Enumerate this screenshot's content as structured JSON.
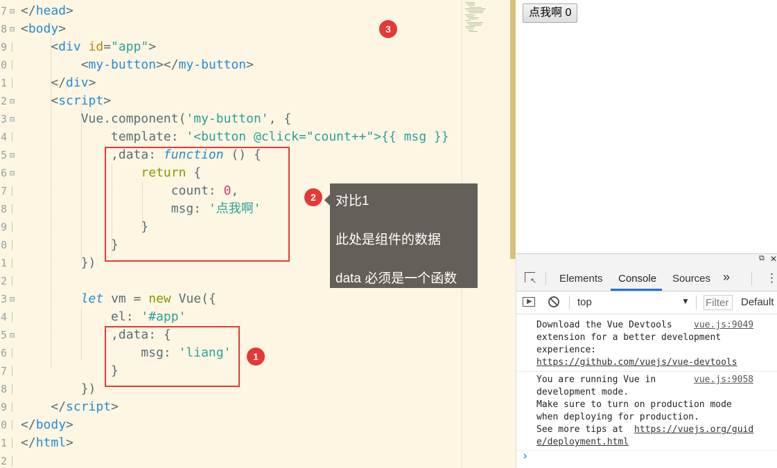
{
  "editor": {
    "line_numbers": [
      "7",
      "8",
      "9",
      "0",
      "1",
      "2",
      "3",
      "4",
      "5",
      "6",
      "7",
      "8",
      "9",
      "0",
      "1",
      "2",
      "3",
      "4",
      "5",
      "6",
      "7",
      "8",
      "9",
      "0",
      "1",
      "2"
    ],
    "lines": [
      [
        [
          "t-punct",
          "</"
        ],
        [
          "t-tag",
          "head"
        ],
        [
          "t-punct",
          ">"
        ]
      ],
      [
        [
          "t-punct",
          "<"
        ],
        [
          "t-tag",
          "body"
        ],
        [
          "t-punct",
          ">"
        ]
      ],
      [
        [
          "t-plain",
          "    "
        ],
        [
          "t-punct",
          "<"
        ],
        [
          "t-tag",
          "div "
        ],
        [
          "t-attr",
          "id"
        ],
        [
          "t-punct",
          "="
        ],
        [
          "t-str",
          "\"app\""
        ],
        [
          "t-punct",
          ">"
        ]
      ],
      [
        [
          "t-plain",
          "        "
        ],
        [
          "t-punct",
          "<"
        ],
        [
          "t-tag",
          "my-button"
        ],
        [
          "t-punct",
          "></"
        ],
        [
          "t-tag",
          "my-button"
        ],
        [
          "t-punct",
          ">"
        ]
      ],
      [
        [
          "t-plain",
          "    "
        ],
        [
          "t-punct",
          "</"
        ],
        [
          "t-tag",
          "div"
        ],
        [
          "t-punct",
          ">"
        ]
      ],
      [
        [
          "t-plain",
          "    "
        ],
        [
          "t-punct",
          "<"
        ],
        [
          "t-tag",
          "script"
        ],
        [
          "t-punct",
          ">"
        ]
      ],
      [
        [
          "t-plain",
          "        Vue.component("
        ],
        [
          "t-str",
          "'my-button'"
        ],
        [
          "t-plain",
          ", {"
        ]
      ],
      [
        [
          "t-plain",
          "            template: "
        ],
        [
          "t-template",
          "'<button @click=\"count++\">{{ msg }}"
        ]
      ],
      [
        [
          "t-plain",
          "            ,data: "
        ],
        [
          "t-italic",
          "function"
        ],
        [
          "t-plain",
          " () {"
        ]
      ],
      [
        [
          "t-plain",
          "                "
        ],
        [
          "t-kw",
          "return "
        ],
        [
          "t-plain",
          "{"
        ]
      ],
      [
        [
          "t-plain",
          "                    count: "
        ],
        [
          "t-num",
          "0"
        ],
        [
          "t-plain",
          ","
        ]
      ],
      [
        [
          "t-plain",
          "                    msg: "
        ],
        [
          "t-str",
          "'点我啊'"
        ]
      ],
      [
        [
          "t-plain",
          "                "
        ],
        [
          "t-plain",
          "}"
        ]
      ],
      [
        [
          "t-plain",
          "            }"
        ]
      ],
      [
        [
          "t-plain",
          "        })"
        ]
      ],
      [
        [
          "t-plain",
          ""
        ]
      ],
      [
        [
          "t-plain",
          "        "
        ],
        [
          "t-italic",
          "let "
        ],
        [
          "t-plain",
          "vm = "
        ],
        [
          "t-kw",
          "new "
        ],
        [
          "t-plain",
          "Vue({"
        ]
      ],
      [
        [
          "t-plain",
          "            el: "
        ],
        [
          "t-str",
          "'#app'"
        ]
      ],
      [
        [
          "t-plain",
          "            ,data: {"
        ]
      ],
      [
        [
          "t-plain",
          "                msg: "
        ],
        [
          "t-str",
          "'liang'"
        ]
      ],
      [
        [
          "t-plain",
          "            }"
        ]
      ],
      [
        [
          "t-plain",
          "        })"
        ]
      ],
      [
        [
          "t-plain",
          "    "
        ],
        [
          "t-punct",
          "</"
        ],
        [
          "t-tag",
          "script"
        ],
        [
          "t-punct",
          ">"
        ]
      ],
      [
        [
          "t-punct",
          "</"
        ],
        [
          "t-tag",
          "body"
        ],
        [
          "t-punct",
          ">"
        ]
      ],
      [
        [
          "t-punct",
          "</"
        ],
        [
          "t-tag",
          "html"
        ],
        [
          "t-punct",
          ">"
        ]
      ],
      [
        [
          "t-plain",
          ""
        ]
      ]
    ],
    "fold_markers": [
      "⊟",
      "⊟",
      "",
      "",
      "",
      "⊟",
      "⊟",
      "",
      "⊟",
      "⊟",
      "",
      "",
      "",
      "",
      "",
      "",
      "⊟",
      "",
      "⊟",
      "",
      "",
      "",
      "",
      "",
      "",
      ""
    ]
  },
  "annotations": {
    "badge_1": "1",
    "badge_2": "2",
    "badge_3": "3",
    "tooltip": {
      "line1": "对比1",
      "line2": "此处是组件的数据",
      "line3": "data 必须是一个函数"
    }
  },
  "preview": {
    "button_label": "点我啊 0"
  },
  "devtools": {
    "tabs": [
      "Elements",
      "Console",
      "Sources"
    ],
    "active_tab": "Console",
    "more_tabs_icon": "»",
    "menu_icon": "⋮",
    "context": "top",
    "filter_placeholder": "Filter",
    "level": "Default",
    "messages": [
      {
        "text": "Download the Vue Devtools\nextension for a better development\nexperience:",
        "link": "https://github.com/vuejs/vue-devtools",
        "source": "vue.js:9049"
      },
      {
        "text": "You are running Vue in\ndevelopment mode.\nMake sure to turn on production mode\nwhen deploying for production.\nSee more tips at ",
        "link": "https://vuejs.org/guide/deployment.html",
        "link_line1": "https://vuejs.org/guid",
        "link_line2": "e/deployment.html",
        "source": "vue.js:9058"
      }
    ],
    "prompt": "›",
    "accent": "#1a73e8"
  }
}
